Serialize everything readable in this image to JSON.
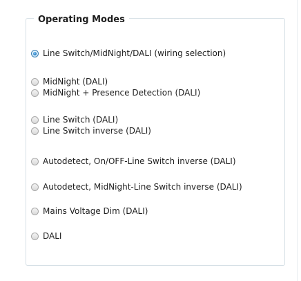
{
  "group": {
    "title": "Operating Modes"
  },
  "selected_index": 0,
  "options": [
    {
      "label": "Line Switch/MidNight/DALI (wiring selection)"
    },
    {
      "label": "MidNight (DALI)"
    },
    {
      "label": "MidNight + Presence Detection (DALI)"
    },
    {
      "label": "Line Switch (DALI)"
    },
    {
      "label": "Line Switch inverse (DALI)"
    },
    {
      "label": "Autodetect, On/OFF-Line Switch inverse (DALI)"
    },
    {
      "label": "Autodetect, MidNight-Line Switch inverse (DALI)"
    },
    {
      "label": "Mains Voltage Dim (DALI)"
    },
    {
      "label": "DALI"
    }
  ],
  "colors": {
    "groupbox_border": "#d5dfe5",
    "radio_selected": "#1b6fb4",
    "text": "#1e1e1e"
  }
}
